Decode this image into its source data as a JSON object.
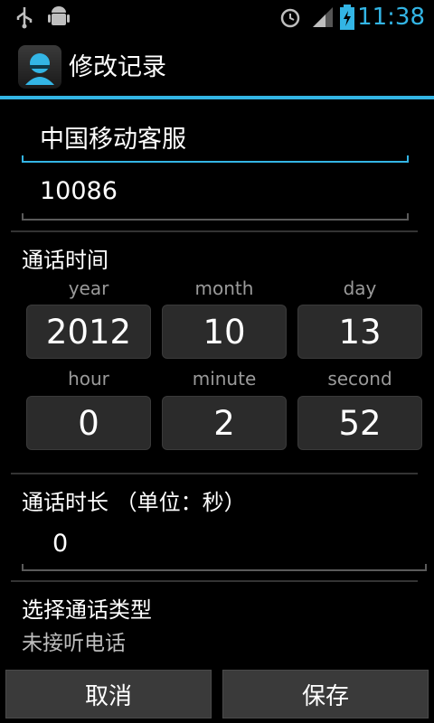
{
  "status_bar": {
    "time": "11:38",
    "left_icons": [
      "usb-icon",
      "android-debug-icon"
    ],
    "right_icons": [
      "alarm-icon",
      "signal-icon",
      "battery-charging-icon"
    ],
    "accent": "#33b5e5"
  },
  "action_bar": {
    "title": "修改记录",
    "icon": "contact-avatar-icon"
  },
  "form": {
    "name_value": "中国移动客服",
    "number_value": "10086",
    "call_time": {
      "title": "通话时间",
      "fields": [
        {
          "label": "year",
          "value": "2012"
        },
        {
          "label": "month",
          "value": "10"
        },
        {
          "label": "day",
          "value": "13"
        },
        {
          "label": "hour",
          "value": "0"
        },
        {
          "label": "minute",
          "value": "2"
        },
        {
          "label": "second",
          "value": "52"
        }
      ]
    },
    "duration": {
      "title": "通话时长 （单位：秒）",
      "value": "0"
    },
    "call_type": {
      "title": "选择通话类型",
      "selected": "未接听电话"
    }
  },
  "buttons": {
    "cancel": "取消",
    "save": "保存"
  }
}
